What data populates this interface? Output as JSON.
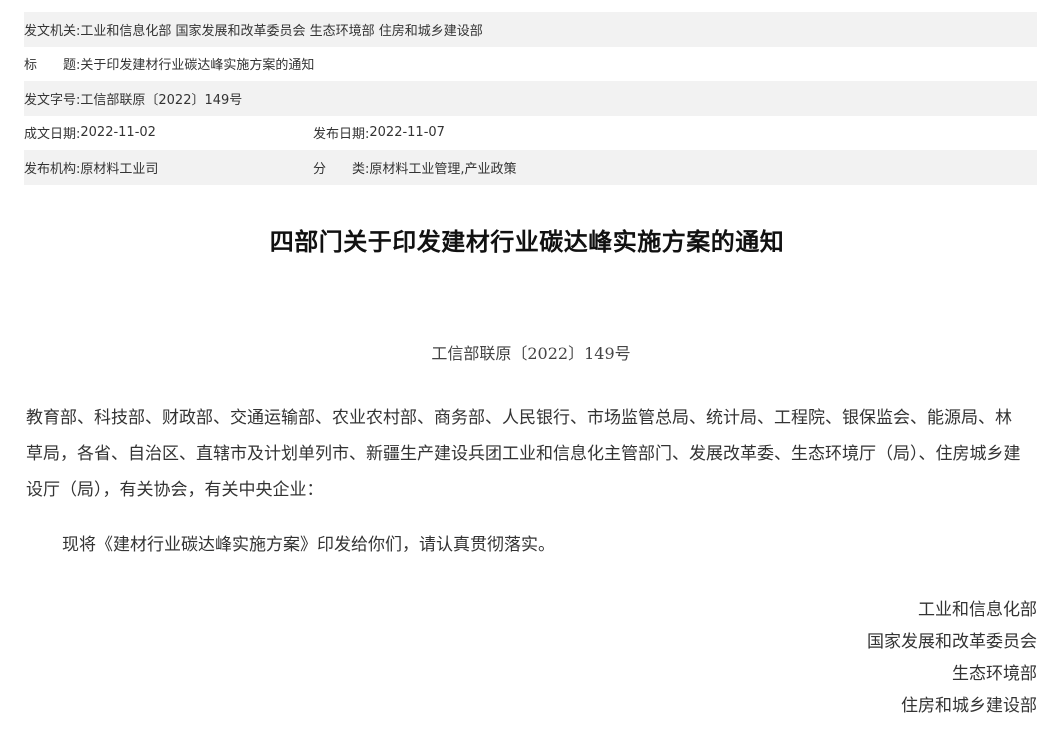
{
  "meta": {
    "issuer_label": "发文机关:",
    "issuer_value": "工业和信息化部 国家发展和改革委员会 生态环境部 住房和城乡建设部",
    "subject_label": "标　　题:",
    "subject_value": "关于印发建材行业碳达峰实施方案的通知",
    "docno_label": "发文字号:",
    "docno_value": "工信部联原〔2022〕149号",
    "created_label": "成文日期:",
    "created_value": "2022-11-02",
    "published_label": "发布日期:",
    "published_value": "2022-11-07",
    "agency_label": "发布机构:",
    "agency_value": "原材料工业司",
    "category_label": "分　　类:",
    "category_value": "原材料工业管理,产业政策"
  },
  "document": {
    "title": "四部门关于印发建材行业碳达峰实施方案的通知",
    "number": "工信部联原〔2022〕149号",
    "recipients": "教育部、科技部、财政部、交通运输部、农业农村部、商务部、人民银行、市场监管总局、统计局、工程院、银保监会、能源局、林草局，各省、自治区、直辖市及计划单列市、新疆生产建设兵团工业和信息化主管部门、发展改革委、生态环境厅（局）、住房城乡建设厅（局），有关协会，有关中央企业：",
    "body": "现将《建材行业碳达峰实施方案》印发给你们，请认真贯彻落实。",
    "signatures": [
      "工业和信息化部",
      "国家发展和改革委员会",
      "生态环境部",
      "住房和城乡建设部"
    ]
  }
}
